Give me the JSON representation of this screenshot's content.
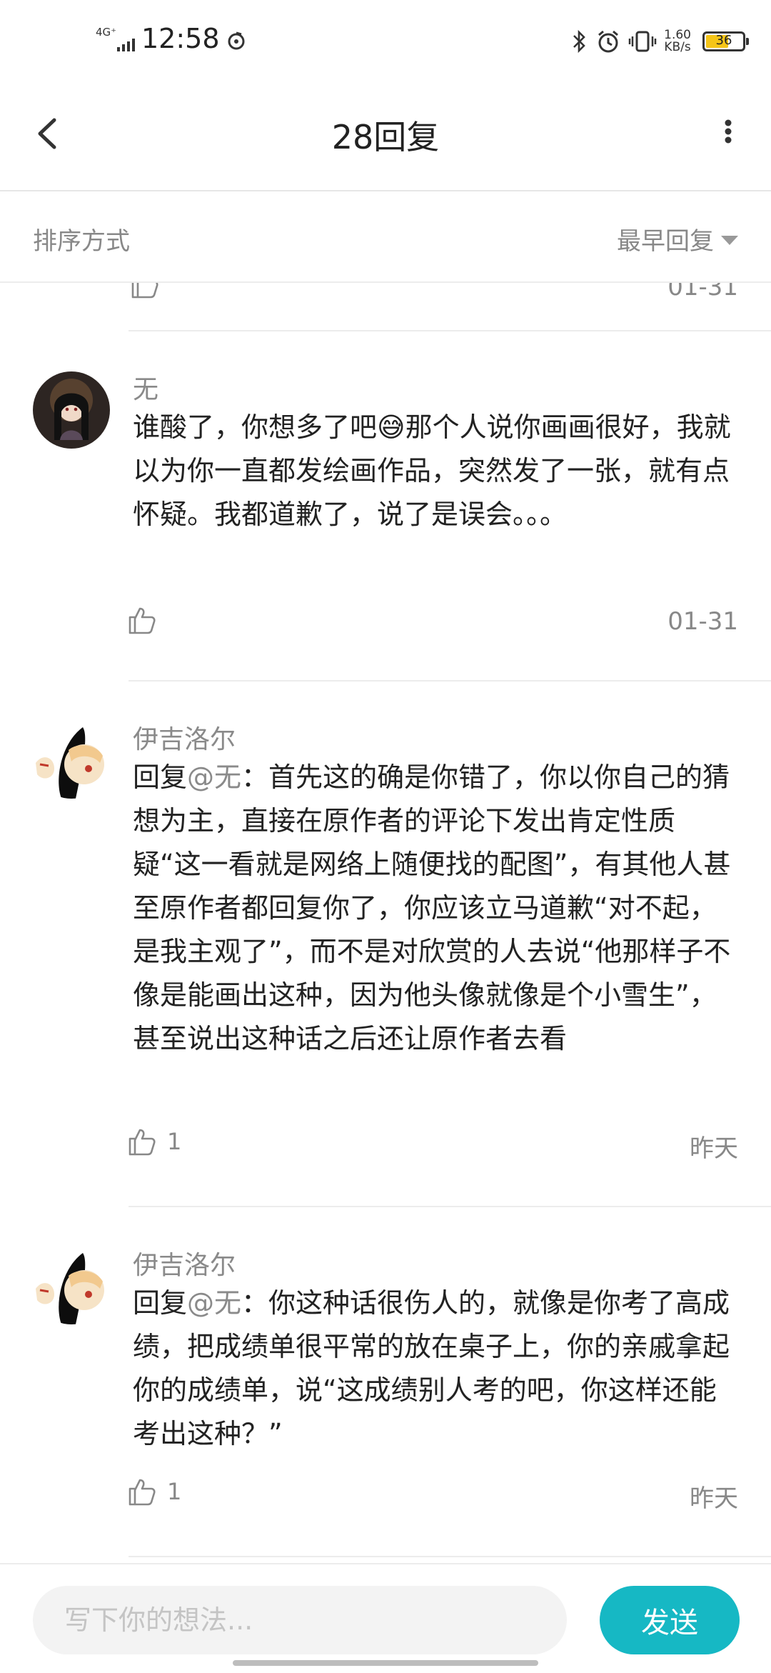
{
  "status_bar": {
    "network": "4G⁺",
    "time": "12:58",
    "speed_value": "1.60",
    "speed_unit": "KB/s",
    "battery": "36"
  },
  "header": {
    "title": "28回复"
  },
  "sort": {
    "label": "排序方式",
    "selected": "最早回复"
  },
  "partial_comment": {
    "date": "01-31"
  },
  "comments": [
    {
      "username": "无",
      "text": "谁酸了，你想多了吧😅那个人说你画画很好，我就以为你一直都发绘画作品，突然发了一张，就有点怀疑。我都道歉了，说了是误会。。。",
      "like_count": "",
      "date": "01-31"
    },
    {
      "username": "伊吉洛尔",
      "reply_prefix": "回复",
      "mention": "@无",
      "text": "：首先这的确是你错了，你以你自己的猜想为主，直接在原作者的评论下发出肯定性质疑“这一看就是网络上随便找的配图”，有其他人甚至原作者都回复你了，你应该立马道歉“对不起，是我主观了”，而不是对欣赏的人去说“他那样子不像是能画出这种，因为他头像就像是个小雪生”，甚至说出这种话之后还让原作者去看",
      "like_count": "1",
      "date": "昨天"
    },
    {
      "username": "伊吉洛尔",
      "reply_prefix": "回复",
      "mention": "@无",
      "text": "：你这种话很伤人的，就像是你考了高成绩，把成绩单很平常的放在桌子上，你的亲戚拿起你的成绩单，说“这成绩别人考的吧，你这样还能考出这种？”",
      "like_count": "1",
      "date": "昨天"
    }
  ],
  "composer": {
    "placeholder": "写下你的想法...",
    "send_label": "发送"
  },
  "colors": {
    "accent": "#16b8c4",
    "muted_text": "#888888",
    "battery": "#f5c518"
  }
}
